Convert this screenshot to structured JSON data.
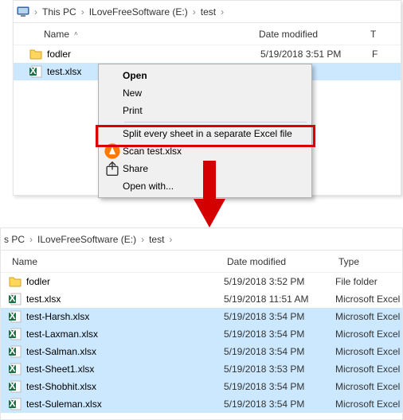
{
  "top": {
    "breadcrumb": [
      "This PC",
      "ILoveFreeSoftware (E:)",
      "test"
    ],
    "headers": {
      "name": "Name",
      "date": "Date modified",
      "type": "T"
    },
    "rows": [
      {
        "icon": "folder",
        "name": "fodler",
        "date": "5/19/2018 3:51 PM",
        "type": "F",
        "selected": false
      },
      {
        "icon": "excel",
        "name": "test.xlsx",
        "date": "",
        "type": "",
        "selected": true
      }
    ]
  },
  "context_menu": {
    "items": [
      {
        "label": "Open",
        "bold": true
      },
      {
        "label": "New"
      },
      {
        "label": "Print"
      },
      {
        "sep": true
      },
      {
        "label": "Split every sheet in a separate Excel file",
        "highlighted": true
      },
      {
        "label": "Scan test.xlsx",
        "icon": "avast"
      },
      {
        "label": "Share",
        "icon": "share"
      },
      {
        "label": "Open with..."
      }
    ]
  },
  "bottom": {
    "breadcrumb": [
      "s PC",
      "ILoveFreeSoftware (E:)",
      "test"
    ],
    "headers": {
      "name": "Name",
      "date": "Date modified",
      "type": "Type"
    },
    "rows": [
      {
        "icon": "folder",
        "name": "fodler",
        "date": "5/19/2018 3:52 PM",
        "type": "File folder",
        "selected": false
      },
      {
        "icon": "excel",
        "name": "test.xlsx",
        "date": "5/19/2018 11:51 AM",
        "type": "Microsoft Excel W...",
        "selected": false
      },
      {
        "icon": "excel",
        "name": "test-Harsh.xlsx",
        "date": "5/19/2018 3:54 PM",
        "type": "Microsoft Excel W...",
        "selected": true
      },
      {
        "icon": "excel",
        "name": "test-Laxman.xlsx",
        "date": "5/19/2018 3:54 PM",
        "type": "Microsoft Excel W...",
        "selected": true
      },
      {
        "icon": "excel",
        "name": "test-Salman.xlsx",
        "date": "5/19/2018 3:54 PM",
        "type": "Microsoft Excel W...",
        "selected": true
      },
      {
        "icon": "excel",
        "name": "test-Sheet1.xlsx",
        "date": "5/19/2018 3:53 PM",
        "type": "Microsoft Excel W...",
        "selected": true
      },
      {
        "icon": "excel",
        "name": "test-Shobhit.xlsx",
        "date": "5/19/2018 3:54 PM",
        "type": "Microsoft Excel W...",
        "selected": true
      },
      {
        "icon": "excel",
        "name": "test-Suleman.xlsx",
        "date": "5/19/2018 3:54 PM",
        "type": "Microsoft Excel W...",
        "selected": true
      }
    ]
  }
}
